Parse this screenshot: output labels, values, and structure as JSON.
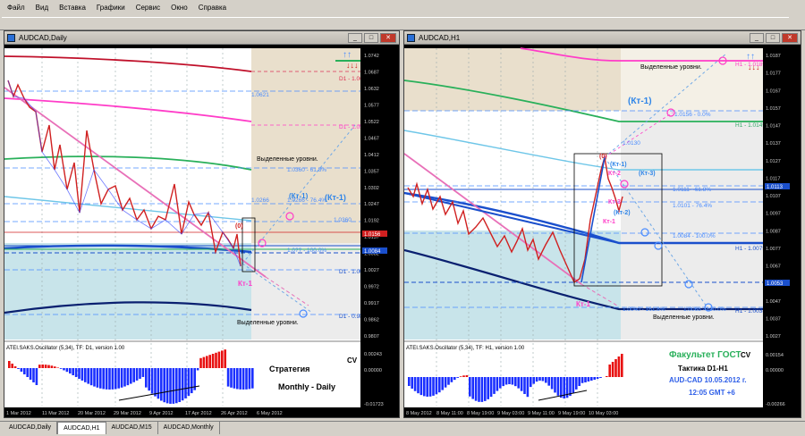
{
  "menu": [
    "Файл",
    "Вид",
    "Вставка",
    "Графики",
    "Сервис",
    "Окно",
    "Справка"
  ],
  "left_window": {
    "title": "AUDCAD,Daily",
    "levels": [
      {
        "label": "D1 - 1.0675",
        "price": "1.0687",
        "color": "#dd3355"
      },
      {
        "label": "D1 - 1.0516",
        "price": "1.0522",
        "color": "#ff3cc8"
      },
      {
        "label": "D1 - 1.0039",
        "price": "",
        "color": "#4a8cff"
      },
      {
        "label": "D1 - 0.9880",
        "price": "",
        "color": "#4a8cff"
      }
    ],
    "fib_labels": [
      "1.0621",
      "1.0266",
      "1.0266 - 76.4%",
      "1.0360 - 61.8%",
      "1.0360",
      "1.0?? - 100.0%"
    ],
    "annotations": {
      "highlighted_levels_1": "Выделенные уровни.",
      "highlighted_levels_2": "Выделенные уровни.",
      "kt1_blue_a": "(Кт-1)",
      "kt1_blue_b": "(Кт-1)",
      "zero": "(0)",
      "kt1_pink": "Кт-1"
    },
    "price_axis": [
      "1.0742",
      "1.0687",
      "1.0632",
      "1.0577",
      "1.0522",
      "1.0467",
      "1.0412",
      "1.0357",
      "1.0302",
      "1.0247",
      "1.0192",
      "1.0137",
      "1.0082",
      "1.0027",
      "0.9972",
      "0.9917",
      "0.9862",
      "0.9807",
      "0.00243",
      "0.00000",
      "-0.01723"
    ],
    "price_tags": [
      {
        "text": "1.0156",
        "color": "#d02020"
      },
      {
        "text": "1.0084",
        "color": "#1a4fcc"
      }
    ],
    "oscillator_label": "ATEI.SAKS.Oscillator (5,34), TF: D1, version 1.00",
    "strategy_cv": "CV",
    "strategy_text": "Стратегия",
    "strategy_sub": "Monthly - Daily",
    "time_axis": [
      "1 Mar 2012",
      "11 Mar 2012",
      "20 Mar 2012",
      "29 Mar 2012",
      "9 Apr 2012",
      "17 Apr 2012",
      "26 Apr 2012",
      "6 May 2012"
    ]
  },
  "right_window": {
    "title": "AUDCAD,H1",
    "levels": [
      {
        "label": "H1 - 1.0189",
        "color": "#ff3cc8"
      },
      {
        "label": "H1 - 1.0149",
        "color": "#33aa66"
      },
      {
        "label": "H1 - 1.0075",
        "color": "#4a8cff"
      },
      {
        "label": "H1 - 1.0038",
        "color": "#4a8cff"
      }
    ],
    "fib_labels": [
      "1.0156 - 0.0%",
      "1.0130",
      "1.0111 - 61.8%",
      "1.0101 - 76.4%",
      "1.0084 - 100.0%",
      "1.0040 - 161.8%",
      "1.0068 - 100.0%"
    ],
    "annotations": {
      "highlighted_levels_1": "Выделенные уровни.",
      "highlighted_levels_2": "Выделенные уровни.",
      "kt1_big": "(Кт-1)",
      "zero": "(0)",
      "kt1_small": "(Кт-1)",
      "kt2": "Кт-2",
      "kt3_blue": "(Кт-3)",
      "kt3": "Кт-3",
      "kt2_blue": "(Кт-2)",
      "kt1_magenta": "Кт-1",
      "kt1_low": "Кт-1"
    },
    "price_axis": [
      "1.0187",
      "1.0177",
      "1.0167",
      "1.0157",
      "1.0147",
      "1.0137",
      "1.0127",
      "1.0117",
      "1.0107",
      "1.0097",
      "1.0087",
      "1.0077",
      "1.0067",
      "1.0057",
      "1.0047",
      "1.0037",
      "1.0027",
      "0.00154",
      "0.00000",
      "-0.00266"
    ],
    "price_tags": [
      {
        "text": "1.0113",
        "color": "#1a4fcc"
      },
      {
        "text": "1.0053",
        "color": "#1a4fcc"
      }
    ],
    "oscillator_label": "ATEI.SAKS.Oscillator (5,34), TF: H1, version 1.00",
    "faculty": "Факультет ГОСТ",
    "faculty_cv": "CV",
    "tactic": "Тактика  D1-H1",
    "pair_date": "AUD-CAD  10.05.2012 г.",
    "time": "12:05  GMT +6",
    "time_axis": [
      "8 May 2012",
      "8 May 11:00",
      "8 May 19:00",
      "9 May 03:00",
      "9 May 11:00",
      "9 May 19:00",
      "10 May 03:00"
    ]
  },
  "tabs": [
    "AUDCAD,Daily",
    "AUDCAD,H1",
    "AUDCAD,M15",
    "AUDCAD,Monthly"
  ],
  "active_tab": "AUDCAD,H1"
}
